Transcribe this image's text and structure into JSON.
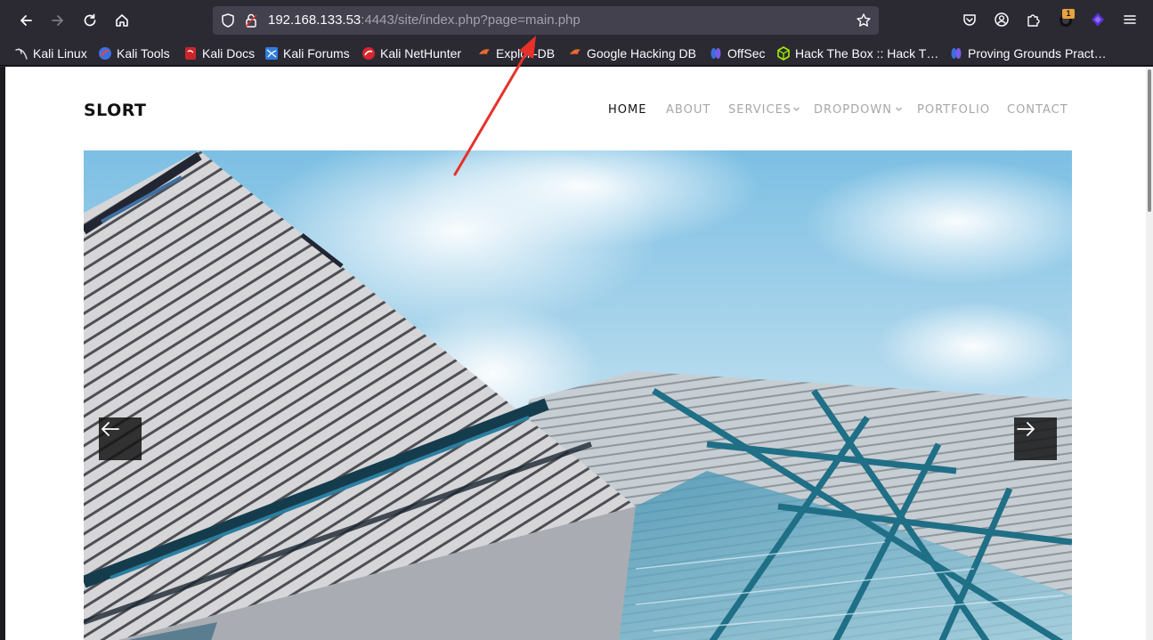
{
  "browser": {
    "url_host": "192.168.133.53",
    "url_rest": ":4443/site/index.php?page=main.php",
    "extensions_badge": "1",
    "bookmarks": [
      {
        "label": "Kali Linux",
        "icon": "kali-dragon-icon"
      },
      {
        "label": "Kali Tools",
        "icon": "kali-tools-icon"
      },
      {
        "label": "Kali Docs",
        "icon": "kali-docs-icon"
      },
      {
        "label": "Kali Forums",
        "icon": "kali-forums-icon"
      },
      {
        "label": "Kali NetHunter",
        "icon": "nethunter-icon"
      },
      {
        "label": "Exploit-DB",
        "icon": "exploit-db-icon"
      },
      {
        "label": "Google Hacking DB",
        "icon": "ghdb-icon"
      },
      {
        "label": "OffSec",
        "icon": "offsec-icon"
      },
      {
        "label": "Hack The Box :: Hack T…",
        "icon": "hackthebox-icon"
      },
      {
        "label": "Proving Grounds Pract…",
        "icon": "proving-grounds-icon"
      }
    ]
  },
  "site": {
    "logo": "SLORT",
    "nav": [
      {
        "label": "HOME",
        "active": true
      },
      {
        "label": "ABOUT",
        "active": false
      },
      {
        "label": "SERVICES",
        "active": false,
        "dropdown": true
      },
      {
        "label": "DROPDOWN",
        "active": false,
        "dropdown": true
      },
      {
        "label": "PORTFOLIO",
        "active": false
      },
      {
        "label": "CONTACT",
        "active": false
      }
    ]
  },
  "colors": {
    "chrome_bg": "#2b2a33",
    "urlbar_bg": "#42414d",
    "annotation_arrow": "#e8302a",
    "nav_active": "#111111",
    "nav_inactive": "#a7a7a7"
  }
}
